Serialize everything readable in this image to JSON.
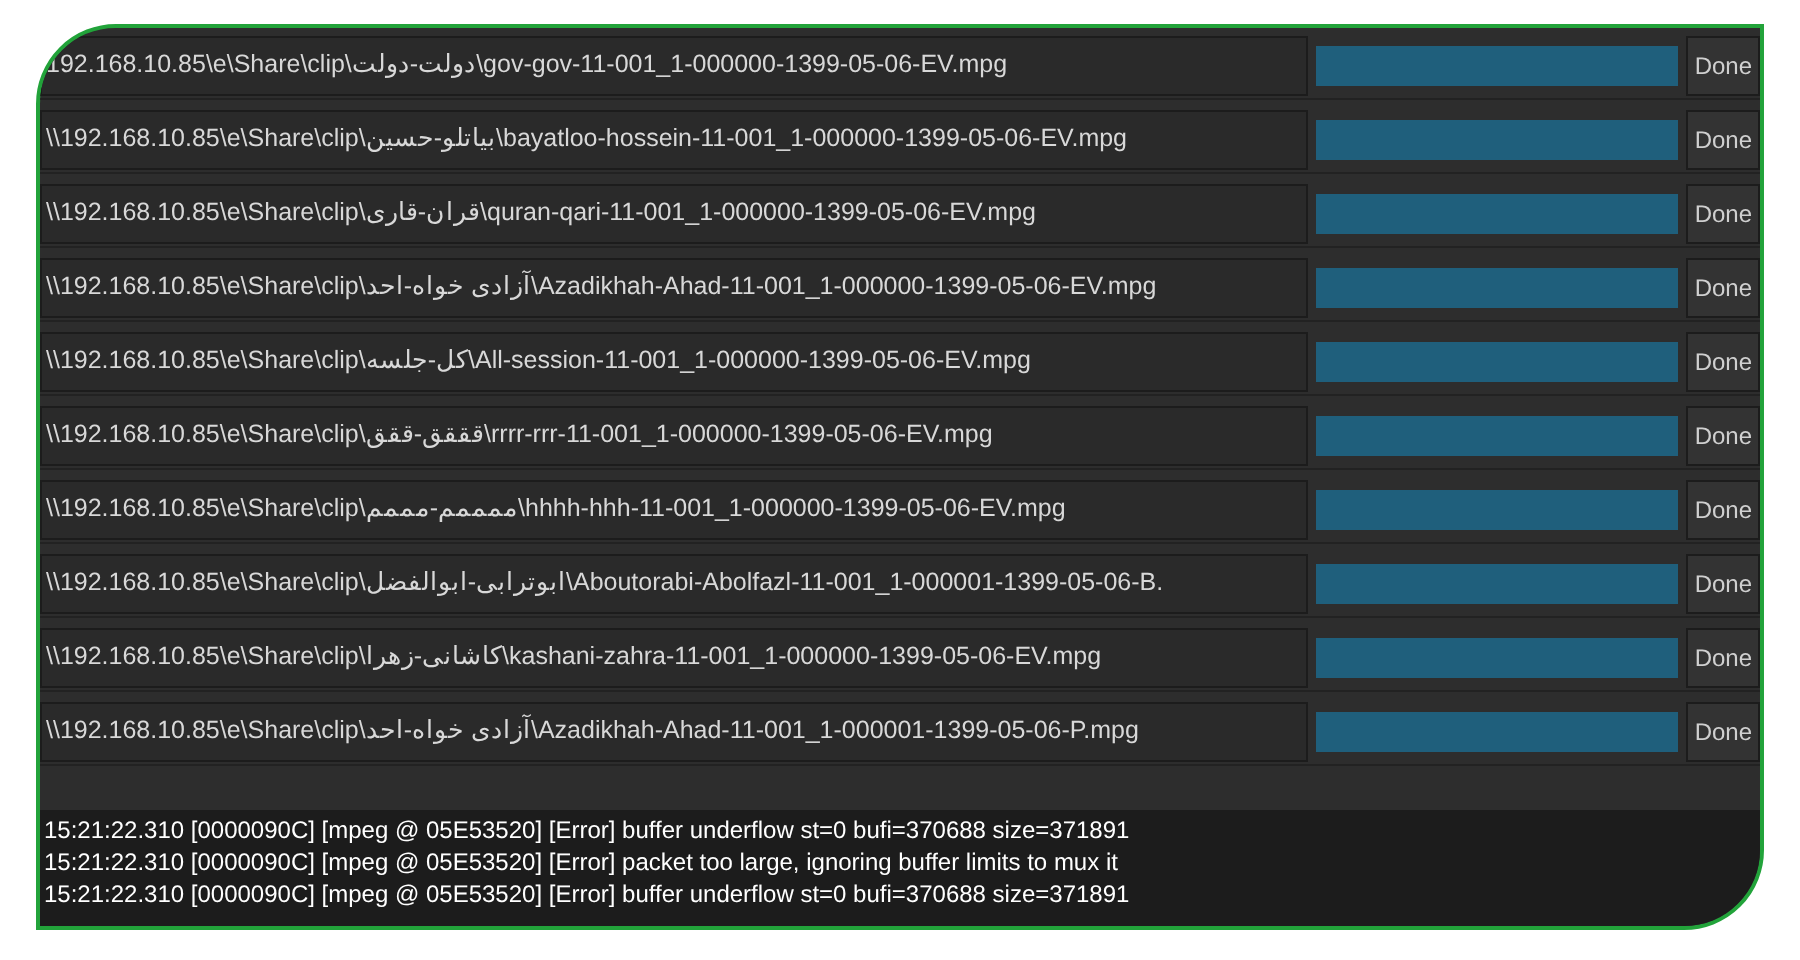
{
  "jobs": [
    {
      "path": "192.168.10.85\\e\\Share\\clip\\دولت-دولت\\gov-gov-11-001_1-000000-1399-05-06-EV.mpg",
      "level": 1,
      "button": "Done"
    },
    {
      "path": "\\\\192.168.10.85\\e\\Share\\clip\\بیاتلو-حسین\\bayatloo-hossein-11-001_1-000000-1399-05-06-EV.mpg",
      "level": 1,
      "button": "Done"
    },
    {
      "path": "\\\\192.168.10.85\\e\\Share\\clip\\قران-قاری\\quran-qari-11-001_1-000000-1399-05-06-EV.mpg",
      "level": 1,
      "button": "Done"
    },
    {
      "path": "\\\\192.168.10.85\\e\\Share\\clip\\آزادی خواه-احد\\Azadikhah-Ahad-11-001_1-000000-1399-05-06-EV.mpg",
      "level": 1,
      "button": "Done"
    },
    {
      "path": "\\\\192.168.10.85\\e\\Share\\clip\\کل-جلسه\\All-session-11-001_1-000000-1399-05-06-EV.mpg",
      "level": 1,
      "button": "Done"
    },
    {
      "path": "\\\\192.168.10.85\\e\\Share\\clip\\قققق-ققق\\rrrr-rrr-11-001_1-000000-1399-05-06-EV.mpg",
      "level": 1,
      "button": "Done"
    },
    {
      "path": "\\\\192.168.10.85\\e\\Share\\clip\\ممممم-مممم\\hhhh-hhh-11-001_1-000000-1399-05-06-EV.mpg",
      "level": 1,
      "button": "Done"
    },
    {
      "path": "\\\\192.168.10.85\\e\\Share\\clip\\ابوترابی-ابوالفضل\\Aboutorabi-Abolfazl-11-001_1-000001-1399-05-06-B.",
      "level": 1,
      "button": "Done"
    },
    {
      "path": "\\\\192.168.10.85\\e\\Share\\clip\\کاشانی-زهرا\\kashani-zahra-11-001_1-000000-1399-05-06-EV.mpg",
      "level": 1,
      "button": "Done"
    },
    {
      "path": "\\\\192.168.10.85\\e\\Share\\clip\\آزادی خواه-احد\\Azadikhah-Ahad-11-001_1-000001-1399-05-06-P.mpg",
      "level": 1,
      "button": "Done"
    }
  ],
  "log": [
    "15:21:22.310 [0000090C] [mpeg @ 05E53520] [Error] buffer underflow st=0 bufi=370688 size=371891",
    "15:21:22.310 [0000090C] [mpeg @ 05E53520] [Error] packet too large, ignoring buffer limits to mux it",
    "15:21:22.310 [0000090C] [mpeg @ 05E53520] [Error] buffer underflow st=0 bufi=370688 size=371891"
  ]
}
